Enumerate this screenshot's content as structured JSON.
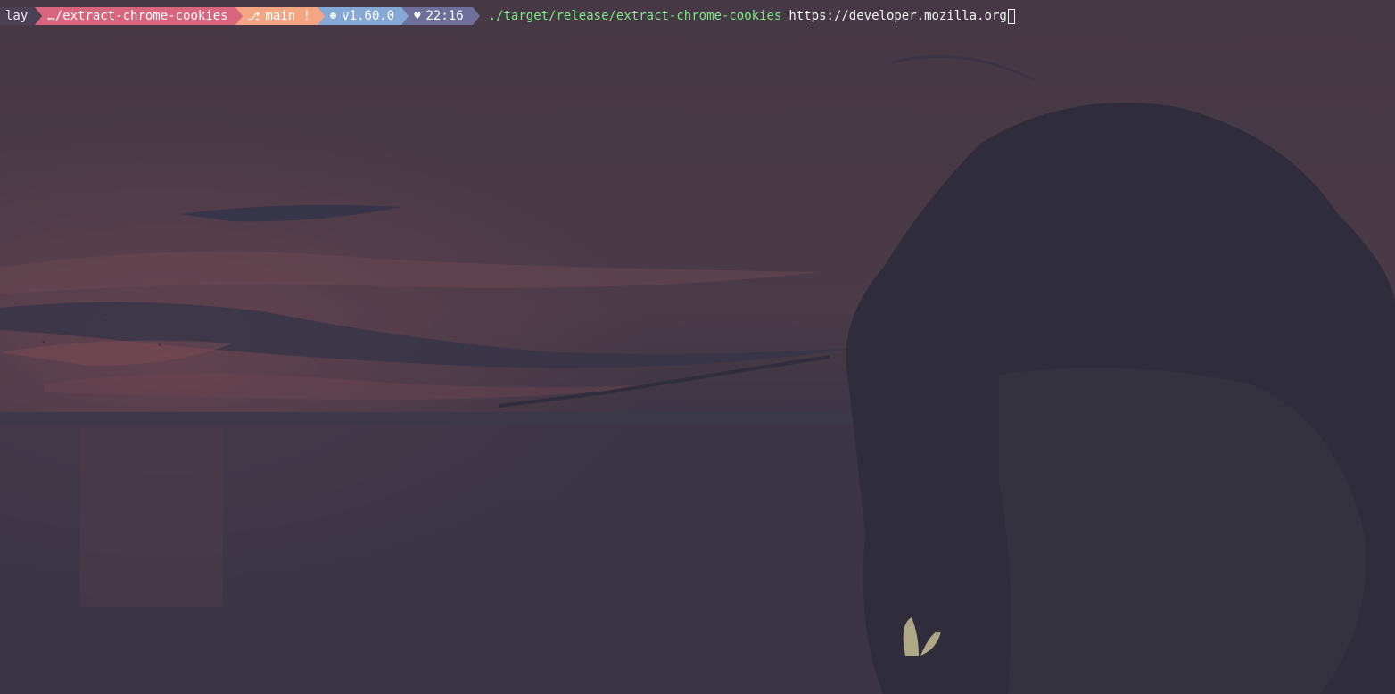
{
  "prompt": {
    "user": "lay",
    "directory": "…/extract-chrome-cookies",
    "git_icon": "git-branch-icon",
    "git_branch": "main !",
    "rust_icon": "rust-icon",
    "rust_version": "v1.60.0",
    "time_icon": "heart-icon",
    "time": "22:16"
  },
  "command": {
    "executable": "./target/release/extract-chrome-cookies",
    "argument": "https://developer.mozilla.org"
  },
  "colors": {
    "user_segment": "#4a4155",
    "dir_segment": "#d9647d",
    "git_segment": "#f4a582",
    "rust_segment": "#86a8d6",
    "time_segment": "#6e6f9a",
    "command": "#7ee787",
    "background": "#3a3342"
  }
}
